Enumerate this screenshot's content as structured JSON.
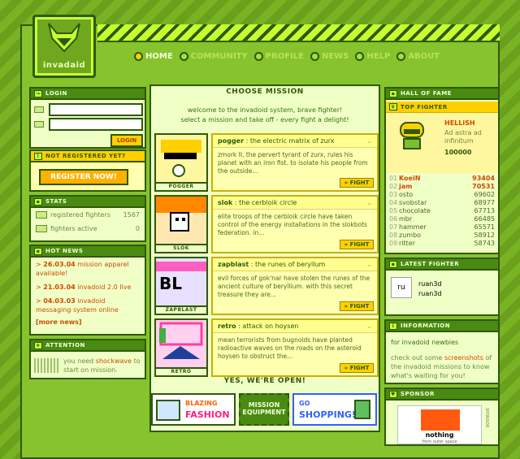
{
  "brand": {
    "logo_text": "invadaid"
  },
  "nav": [
    {
      "label": "HOME",
      "active": true
    },
    {
      "label": "COMMUNITY",
      "active": false
    },
    {
      "label": "PROFILE",
      "active": false
    },
    {
      "label": "NEWS",
      "active": false
    },
    {
      "label": "HELP",
      "active": false
    },
    {
      "label": "ABOUT",
      "active": false
    }
  ],
  "login": {
    "title": "LOGIN",
    "button": "LOGIN",
    "username_value": "",
    "password_value": ""
  },
  "register": {
    "title": "NOT REGISTERED YET?",
    "button": "REGISTER NOW!"
  },
  "stats": {
    "title": "STATS",
    "rows": [
      {
        "label": "registered fighters",
        "value": "1567"
      },
      {
        "label": "fighters active",
        "value": "0"
      }
    ]
  },
  "hot_news": {
    "title": "HOT NEWS",
    "items": [
      {
        "date": "26.03.04",
        "text": "mission apparel available!"
      },
      {
        "date": "21.03.04",
        "text": "invadoid 2.0 live"
      },
      {
        "date": "04.03.03",
        "text": "invadoid messaging system online"
      }
    ],
    "more": "[more news]"
  },
  "attention": {
    "title": "ATTENTION",
    "text_pre": "you need ",
    "text_link": "shockwave",
    "text_post": " to start on mission."
  },
  "missions": {
    "title": "CHOOSE MISSION",
    "intro_line1": "welcome to the invadoid system, brave fighter!",
    "intro_line2": "select a mission and take off - every fight a delight!",
    "fight_label": "FIGHT",
    "items": [
      {
        "name": "pogger",
        "subtitle": ": the electric matrix of zurx",
        "thumb": "POGGER",
        "desc": "zmork II, the pervert tyrant of zurx, rules his planet with an iron fist. to isolate his people from the outside..."
      },
      {
        "name": "slok",
        "subtitle": ": the cerbloik circle",
        "thumb": "SLOK",
        "desc": "elite troops of the energy installations in the slokbots federation. in..."
      },
      {
        "name": "zapblast",
        "subtitle": ": the runes of beryllum",
        "thumb": "ZAPBLAST",
        "desc": "evil forces of gok'nar have stolen the runes of the ancient culture of beryllium. with this secret treasure they are..."
      },
      {
        "name": "retro",
        "subtitle": ": attack on hoysen",
        "thumb": "RETRO",
        "desc": "mean terrorists from bugnolds have planted radioactive waves on the roads on the asteroid hoysen to obstruct the..."
      }
    ],
    "slok_desc_start": "elite troops of the cerbloik circle have taken control of the energy installations in the slokbots federation. in..."
  },
  "open": {
    "title": "YES, WE'RE OPEN!",
    "promo1_line1": "BLAZING",
    "promo1_line2": "FASHION",
    "promo2_line1": "MISSION",
    "promo2_line2": "EQUIPMENT",
    "promo3_line1": "GO",
    "promo3_line2": "SHOPPING!"
  },
  "hall_of_fame": {
    "title": "HALL OF FAME",
    "top_title": "TOP FIGHTER",
    "top_name": "HELLiSH",
    "top_motto": "Ad astra ad infinitum",
    "top_score": "100000",
    "rows": [
      {
        "rank": "01",
        "name": "KoeiN",
        "score": "93404",
        "top": true
      },
      {
        "rank": "02",
        "name": "jam",
        "score": "70531",
        "top": true
      },
      {
        "rank": "03",
        "name": "osto",
        "score": "69602",
        "top": false
      },
      {
        "rank": "04",
        "name": "svobstar",
        "score": "68977",
        "top": false
      },
      {
        "rank": "05",
        "name": "chocolate",
        "score": "67713",
        "top": false
      },
      {
        "rank": "06",
        "name": "mbr",
        "score": "66485",
        "top": false
      },
      {
        "rank": "07",
        "name": "hammer",
        "score": "65571",
        "top": false
      },
      {
        "rank": "08",
        "name": "zumbo",
        "score": "58912",
        "top": false
      },
      {
        "rank": "09",
        "name": "ritter",
        "score": "58743",
        "top": false
      }
    ]
  },
  "latest_fighter": {
    "title": "LATEST FIGHTER",
    "avatar_text": "ru",
    "name1": "ruan3d",
    "name2": "ruan3d"
  },
  "information": {
    "title": "INFORMATION",
    "heading": "for invadoid newbies",
    "text_pre": "check out some ",
    "text_link": "screenshots",
    "text_post": " of the invadoid missions to know what's waiting for you!"
  },
  "sponsor": {
    "title": "SPONSOR",
    "name": "nothing",
    "tagline": "from outer space",
    "side_label": "SPONSOR"
  },
  "colors": {
    "accent": "#ffd000",
    "dark": "#2d5a0a",
    "bright": "#c8ff30"
  }
}
